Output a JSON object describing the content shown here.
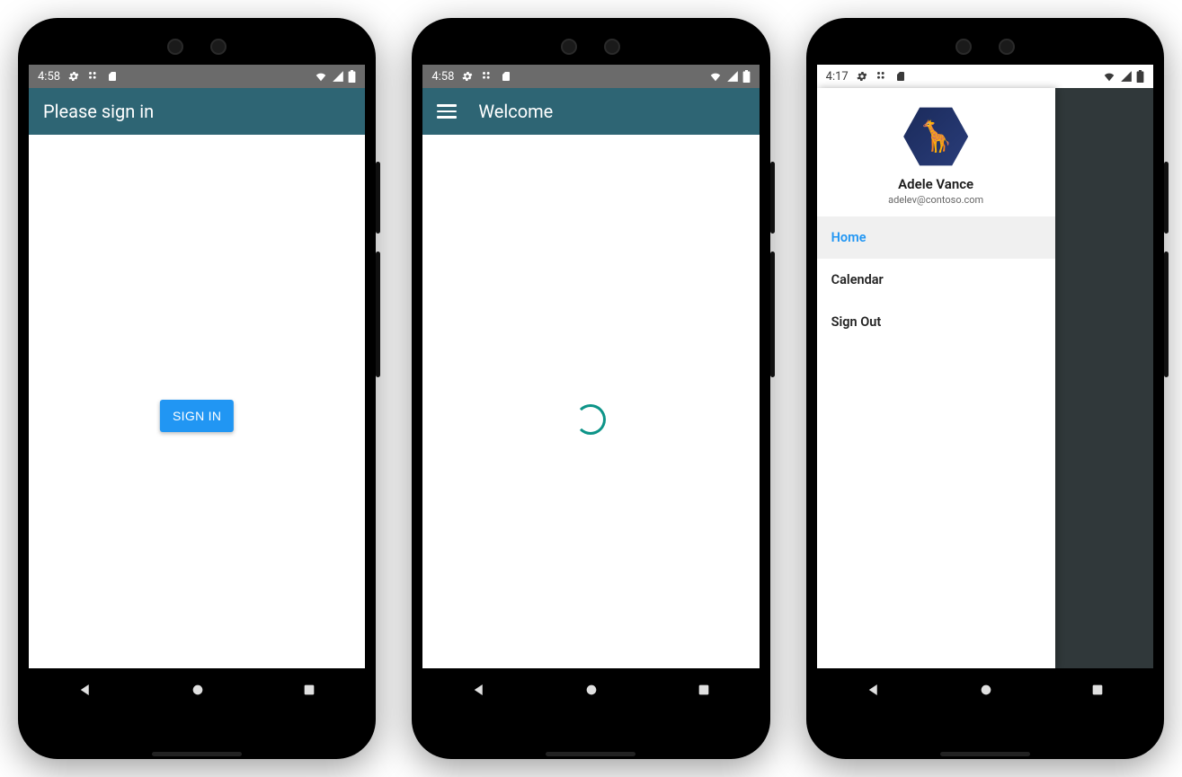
{
  "colors": {
    "appbar": "#2e6574",
    "accent": "#2196f3",
    "spinner": "#0d9488"
  },
  "screen1": {
    "status_time": "4:58",
    "appbar_title": "Please sign in",
    "signin_button": "SIGN IN"
  },
  "screen2": {
    "status_time": "4:58",
    "appbar_title": "Welcome"
  },
  "screen3": {
    "status_time": "4:17",
    "user_name": "Adele Vance",
    "user_email": "adelev@contoso.com",
    "drawer_items": [
      "Home",
      "Calendar",
      "Sign Out"
    ],
    "active_item_index": 0
  }
}
